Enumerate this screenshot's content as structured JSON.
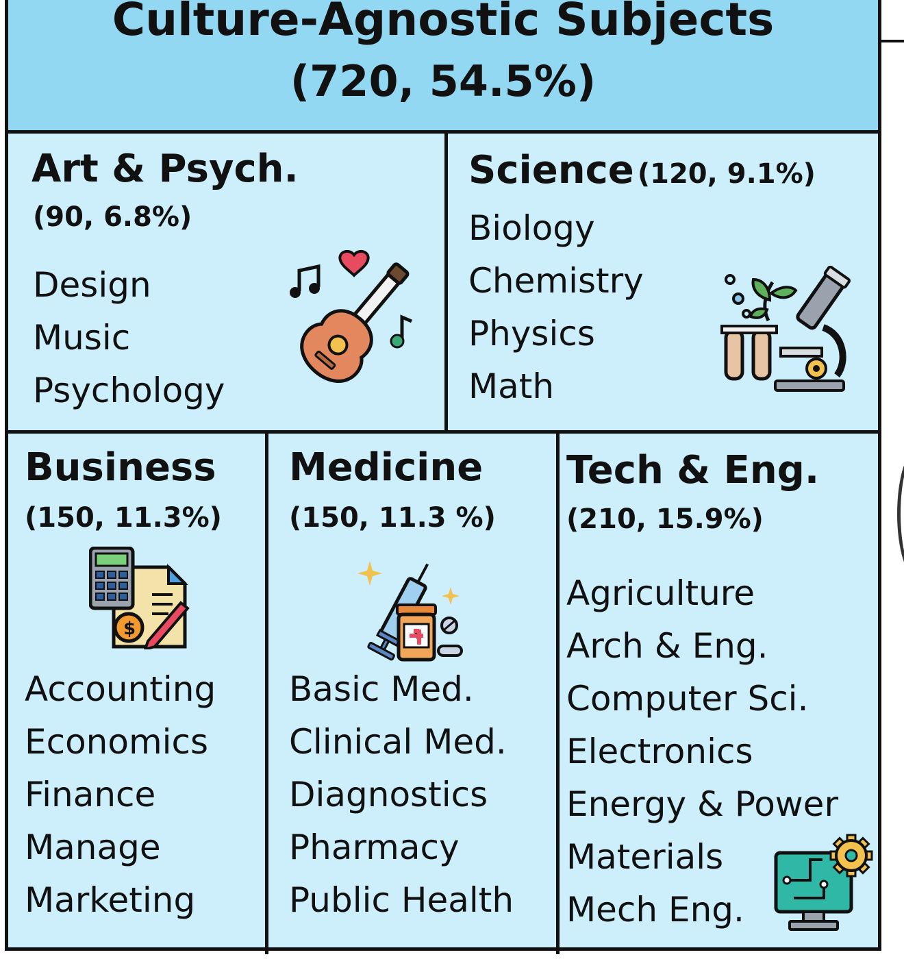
{
  "header": {
    "title": "Culture-Agnostic Subjects",
    "subtitle": "(720, 54.5%)"
  },
  "categories": [
    {
      "name": "Art & Psych.",
      "count": "(90, 6.8%)",
      "icon": "guitar-music-icon",
      "items": [
        "Design",
        "Music",
        "Psychology"
      ]
    },
    {
      "name": "Science",
      "count": "(120, 9.1%)",
      "icon": "microscope-icon",
      "items": [
        "Biology",
        "Chemistry",
        "Physics",
        "Math"
      ]
    },
    {
      "name": "Business",
      "count": "(150, 11.3%)",
      "icon": "calculator-invoice-icon",
      "items": [
        "Accounting",
        "Economics",
        "Finance",
        "Manage",
        "Marketing"
      ]
    },
    {
      "name": "Medicine",
      "count": "(150, 11.3 %)",
      "icon": "syringe-pills-icon",
      "items": [
        "Basic Med.",
        "Clinical Med.",
        "Diagnostics",
        "Pharmacy",
        "Public Health"
      ]
    },
    {
      "name": "Tech & Eng.",
      "count": "(210, 15.9%)",
      "icon": "computer-gear-icon",
      "items": [
        "Agriculture",
        "Arch & Eng.",
        "Computer Sci.",
        "Electronics",
        "Energy & Power",
        "Materials",
        "Mech Eng."
      ]
    }
  ]
}
